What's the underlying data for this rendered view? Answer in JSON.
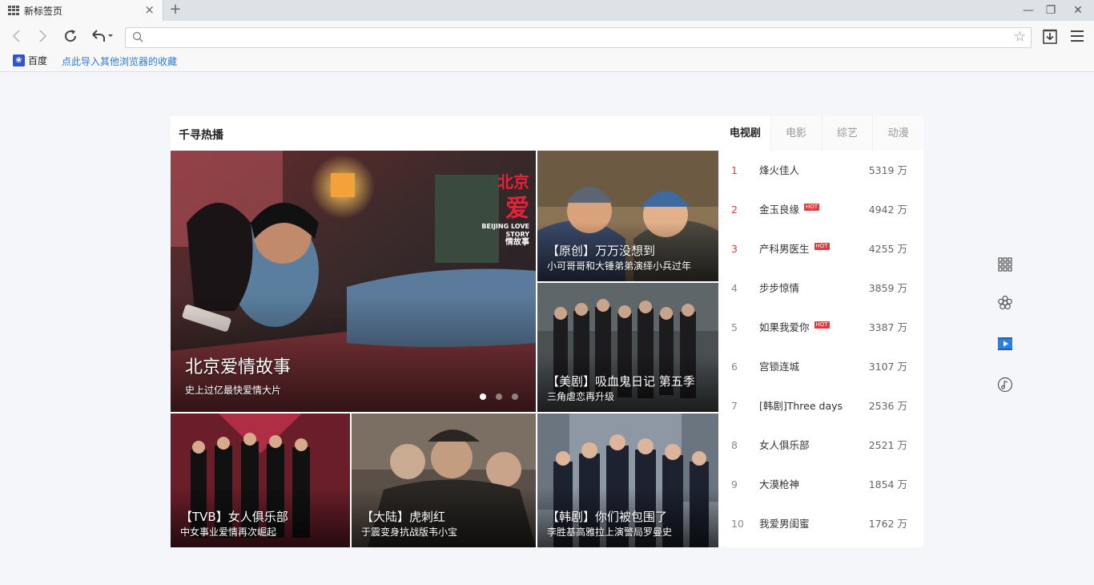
{
  "browser": {
    "tab_title": "新标签页",
    "tab_close": "×",
    "new_tab": "+",
    "win_min": "—",
    "win_restore": "❐",
    "win_close": "✕",
    "address_value": "",
    "address_placeholder": ""
  },
  "bookmarks": {
    "baidu_label": "百度",
    "import_label": "点此导入其他浏览器的收藏"
  },
  "panel": {
    "title": "千寻热播",
    "featured": {
      "title": "北京爱情故事",
      "subtitle": "史上过亿最快爱情大片",
      "logo_en": "BEIJING LOVE STORY",
      "logo_cn_1": "北京",
      "logo_cn_2": "爱",
      "logo_cn_3": "情故事"
    },
    "tiles": [
      {
        "title": "【原创】万万没想到",
        "subtitle": "小可哥哥和大锤弟弟演绎小兵过年"
      },
      {
        "title": "【美剧】吸血鬼日记 第五季",
        "subtitle": "三角虐恋再升级"
      },
      {
        "title": "【TVB】女人俱乐部",
        "subtitle": "中女事业爱情再次崛起"
      },
      {
        "title": "【大陆】虎刺红",
        "subtitle": "于震变身抗战版韦小宝"
      },
      {
        "title": "【韩剧】你们被包围了",
        "subtitle": "李胜基高雅拉上演警局罗曼史"
      }
    ]
  },
  "ranking": {
    "tabs": [
      "电视剧",
      "电影",
      "综艺",
      "动漫"
    ],
    "active_tab": 0,
    "hot_label": "HOT",
    "items": [
      {
        "rank": "1",
        "name": "烽火佳人",
        "count": "5319 万",
        "hot": false
      },
      {
        "rank": "2",
        "name": "金玉良缘",
        "count": "4942 万",
        "hot": true
      },
      {
        "rank": "3",
        "name": "产科男医生",
        "count": "4255 万",
        "hot": true
      },
      {
        "rank": "4",
        "name": "步步惊情",
        "count": "3859 万",
        "hot": false
      },
      {
        "rank": "5",
        "name": "如果我爱你",
        "count": "3387 万",
        "hot": true
      },
      {
        "rank": "6",
        "name": "宫锁连城",
        "count": "3107 万",
        "hot": false
      },
      {
        "rank": "7",
        "name": "[韩剧]Three days",
        "count": "2536 万",
        "hot": false
      },
      {
        "rank": "8",
        "name": "女人俱乐部",
        "count": "2521 万",
        "hot": false
      },
      {
        "rank": "9",
        "name": "大漠枪神",
        "count": "1854 万",
        "hot": false
      },
      {
        "rank": "10",
        "name": "我爱男闺蜜",
        "count": "1762 万",
        "hot": false
      }
    ]
  },
  "colors": {
    "accent_red": "#e4393c",
    "link_blue": "#2c7bd6"
  },
  "icons": [
    "apps-grid-icon",
    "flower-icon",
    "video-play-icon",
    "music-note-icon"
  ]
}
